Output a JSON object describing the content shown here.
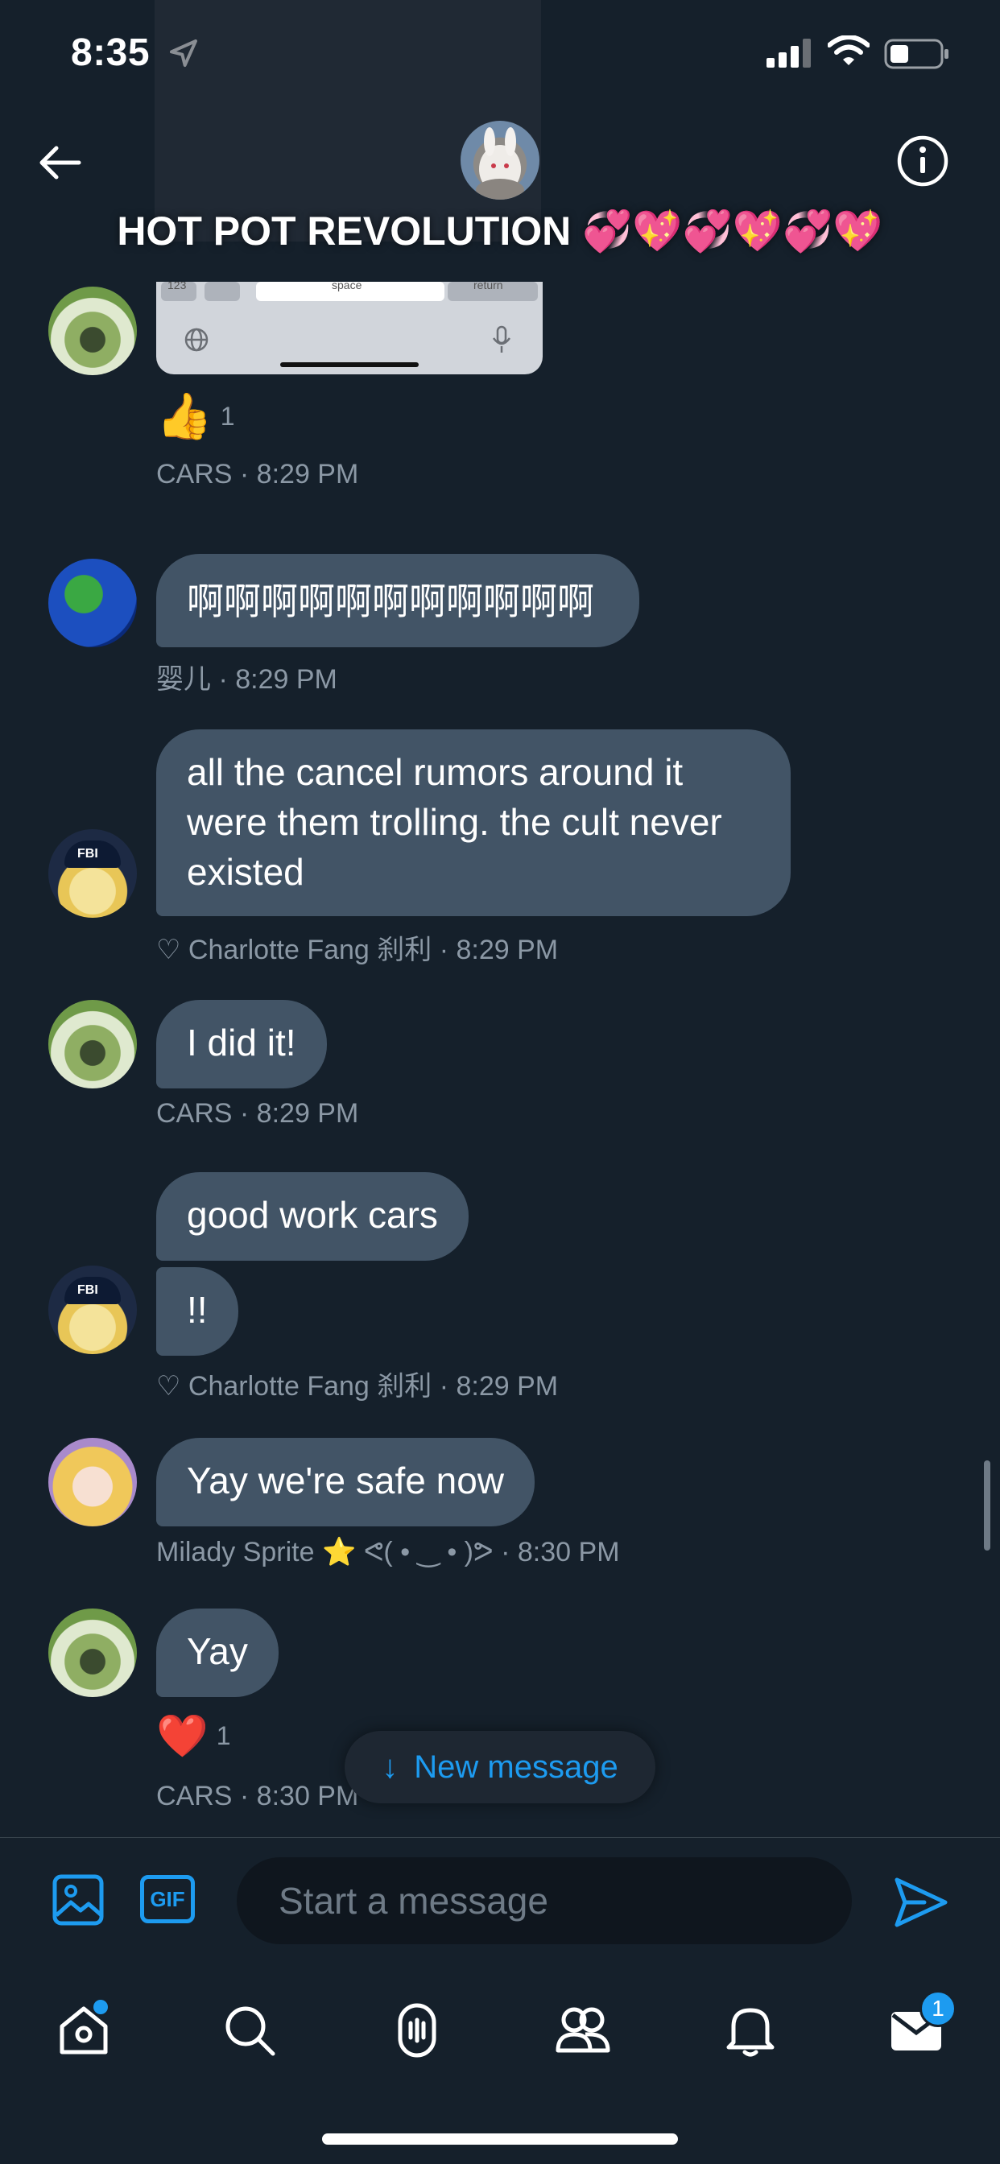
{
  "status_bar": {
    "time": "8:35",
    "icons": [
      "location-arrow-icon",
      "cellular-signal-icon",
      "wifi-icon",
      "battery-icon"
    ]
  },
  "header": {
    "title": "HOT POT REVOLUTION 💞💖💞💖💞💖",
    "back_icon": "arrow-left-icon",
    "info_icon": "info-circle-icon"
  },
  "image_preview_keys": {
    "key_123": "123",
    "key_space": "space",
    "key_return": "return"
  },
  "messages": [
    {
      "type": "image",
      "reaction": {
        "emoji": "👍",
        "count": "1"
      },
      "meta": "CARS · 8:29 PM"
    },
    {
      "text": "啊啊啊啊啊啊啊啊啊啊啊",
      "meta": "婴儿 · 8:29 PM"
    },
    {
      "text": "all the cancel rumors around it were them trolling. the cult never existed",
      "meta": "♡ Charlotte Fang 刹利 · 8:29 PM"
    },
    {
      "text": "I did it!",
      "meta": "CARS · 8:29 PM"
    },
    {
      "text": "good work cars",
      "text2": "!!",
      "meta": "♡ Charlotte Fang 刹利 · 8:29 PM"
    },
    {
      "text": "Yay we're safe now",
      "meta": "Milady Sprite ⭐ ᕙ( • ‿ • )ᕗ · 8:30 PM"
    },
    {
      "text": "Yay",
      "reaction": {
        "emoji": "❤️",
        "count": "1"
      },
      "meta": "CARS · 8:30 PM"
    }
  ],
  "new_message_pill": {
    "arrow": "↓",
    "label": "New message"
  },
  "composer": {
    "placeholder": "Start a message",
    "gif_label": "GIF",
    "media_icon": "image-icon",
    "send_icon": "send-icon"
  },
  "tab_bar": {
    "tabs": [
      "home-icon",
      "search-icon",
      "spaces-icon",
      "communities-icon",
      "notifications-icon",
      "messages-icon"
    ],
    "messages_badge": "1"
  },
  "colors": {
    "background": "#15202b",
    "bubble": "#425466",
    "accent": "#1d9bf0",
    "meta_text": "#8b98a5"
  }
}
